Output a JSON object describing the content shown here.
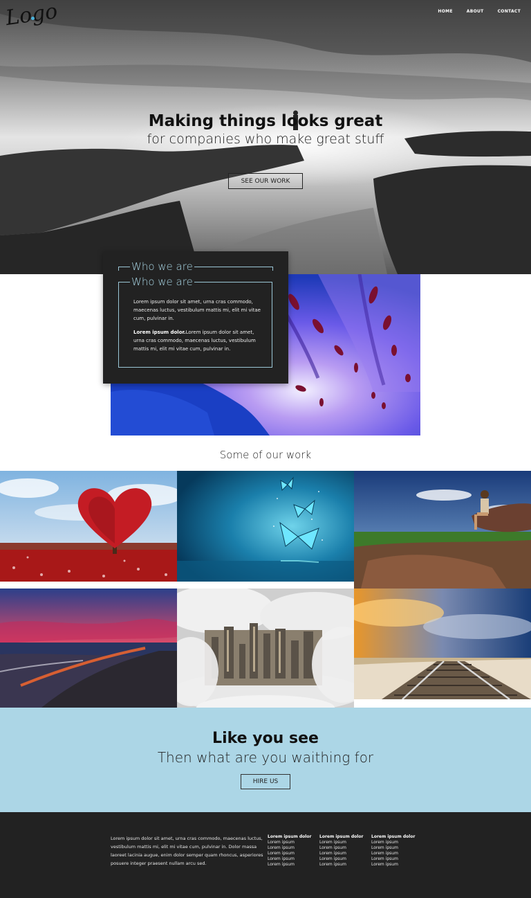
{
  "brand": {
    "logo_text": "Logo",
    "accent_color": "#4ab3dc"
  },
  "nav": {
    "items": [
      "HOME",
      "ABOUT",
      "CONTACT"
    ]
  },
  "hero": {
    "title": "Making things looks great",
    "subtitle": "for companies who make great stuff",
    "button_label": "SEE OUR WORK"
  },
  "about": {
    "heading": "Who we are",
    "heading_repeat": "Who we are",
    "paragraph1": "Lorem ipsum dolor sit amet, urna cras commodo, maecenas luctus, vestibulum mattis mi, elit mi vitae cum, pulvinar in.",
    "paragraph2_bold": "Lorem ipsum dolor.",
    "paragraph2_rest": "Lorem ipsum dolor sit amet, urna cras commodo, maecenas luctus, vestibulum mattis mi, elit mi vitae cum, pulvinar in."
  },
  "work": {
    "title": "Some of our work",
    "items": [
      "heart-tree",
      "blue-butterflies",
      "hiker-on-rock",
      "sunset-beach",
      "city-in-clouds",
      "railway-sunset"
    ]
  },
  "cta": {
    "title": "Like you see",
    "subtitle": "Then what are you waithing for",
    "button_label": "HIRE US"
  },
  "footer": {
    "text": "Lorem ipsum dolor sit amet, urna cras commodo, maecenas luctus, vestibulum mattis mi, elit mi vitae cum, pulvinar in. Dolor massa laoreet lacinia augue, enim dolor semper quam rhoncus, asperiores posuere integer praesent nullam arcu sed.",
    "columns": [
      {
        "heading": "Lorem ipsum dolor",
        "links": [
          "Lorem ipsum",
          "Lorem ipsum",
          "Lorem ipsum",
          "Lorem ipsum",
          "Lorem ipsum"
        ]
      },
      {
        "heading": "Lorem ipsum dolor",
        "links": [
          "Lorem ipsum",
          "Lorem ipsum",
          "Lorem ipsum",
          "Lorem ipsum",
          "Lorem ipsum"
        ]
      },
      {
        "heading": "Lorem ipsum dolor",
        "links": [
          "Lorem ipsum",
          "Lorem ipsum",
          "Lorem ipsum",
          "Lorem ipsum",
          "Lorem ipsum"
        ]
      }
    ]
  }
}
